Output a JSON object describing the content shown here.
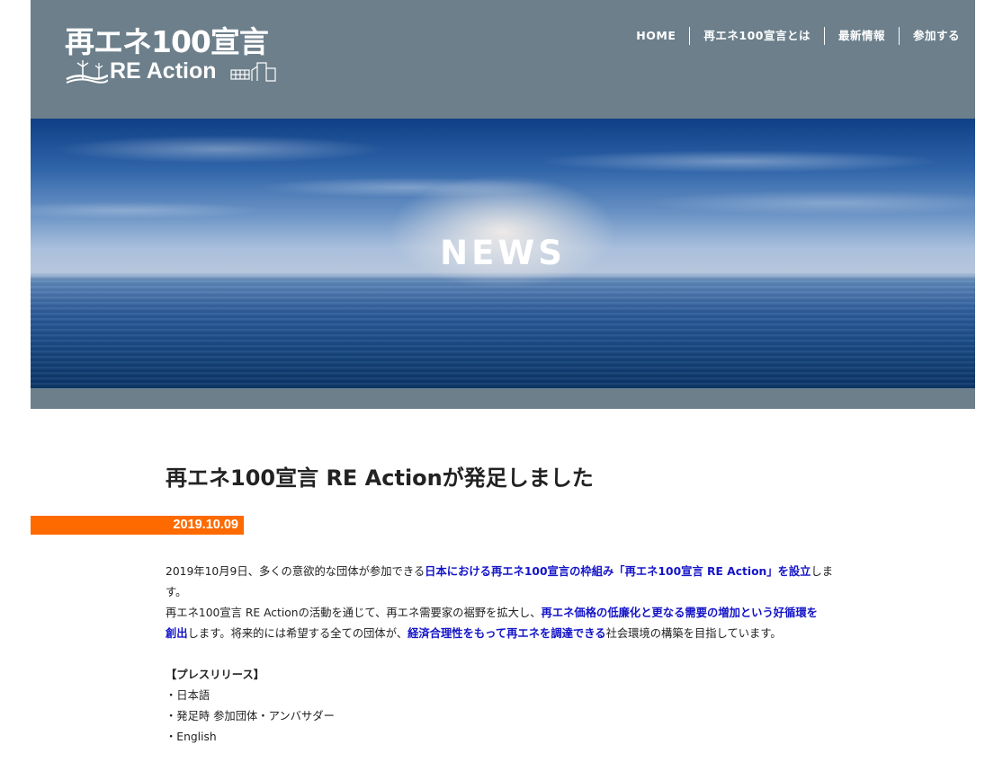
{
  "logo": {
    "title_ja": "再エネ100宣言",
    "title_en": "RE Action"
  },
  "nav": {
    "items": [
      {
        "label": "HOME"
      },
      {
        "label": "再エネ100宣言とは"
      },
      {
        "label": "最新情報"
      },
      {
        "label": "参加する"
      }
    ]
  },
  "hero": {
    "title": "NEWS"
  },
  "article": {
    "title": "再エネ100宣言 RE Actionが発足しました",
    "date": "2019.10.09",
    "para1": {
      "a": "2019年10月9日、多くの意欲的な団体が参加できる",
      "b": "日本における再エネ100宣言の枠組み「再エネ100宣言 RE Action」を設立",
      "c": "しま",
      "d": "す。"
    },
    "para2": {
      "a": "再エネ100宣言 RE Actionの活動を通じて、再エネ需要家の裾野を拡大し、",
      "b": "再エネ価格の低廉化と更なる需要の増加という好循環を",
      "c": "創出",
      "d": "します。将来的には希望する全ての団体が、",
      "e": "経済合理性をもって再エネを調達できる",
      "f": "社会環境の構築を目指しています。"
    },
    "press_heading": "【プレスリリース】",
    "press_items": [
      {
        "label": "・日本語"
      },
      {
        "label": "・発足時 参加団体・アンバサダー"
      },
      {
        "label": "・English"
      }
    ]
  },
  "colors": {
    "header_bg": "#6c7f8b",
    "accent_orange": "#ff6a00",
    "highlight_blue": "#1414c8"
  }
}
